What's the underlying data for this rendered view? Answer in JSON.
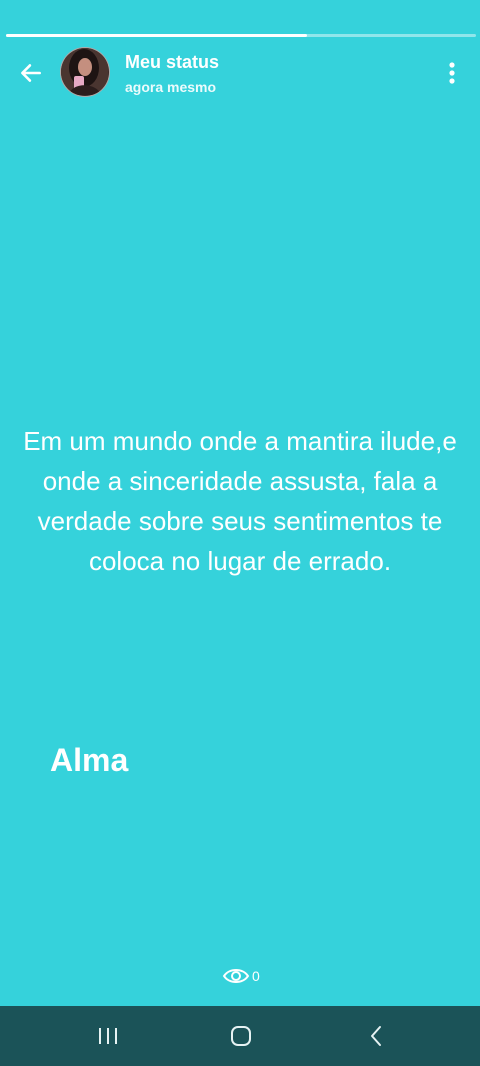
{
  "status_progress": 0.64,
  "header": {
    "title": "Meu status",
    "time": "agora mesmo"
  },
  "content": {
    "text": "Em um mundo onde a mantira ilude,e onde a sinceridade assusta, fala a verdade sobre seus sentimentos te coloca no lugar de errado.",
    "signature": "Alma",
    "background_color": "#35d2db"
  },
  "footer": {
    "views_count": "0"
  },
  "icons": {
    "back": "arrow-left-icon",
    "menu": "more-vertical-icon",
    "views": "eye-icon",
    "nav_recents": "recents-icon",
    "nav_home": "home-icon",
    "nav_back": "chevron-left-icon"
  },
  "colors": {
    "navbar": "#1b5358",
    "text": "#ffffff"
  }
}
